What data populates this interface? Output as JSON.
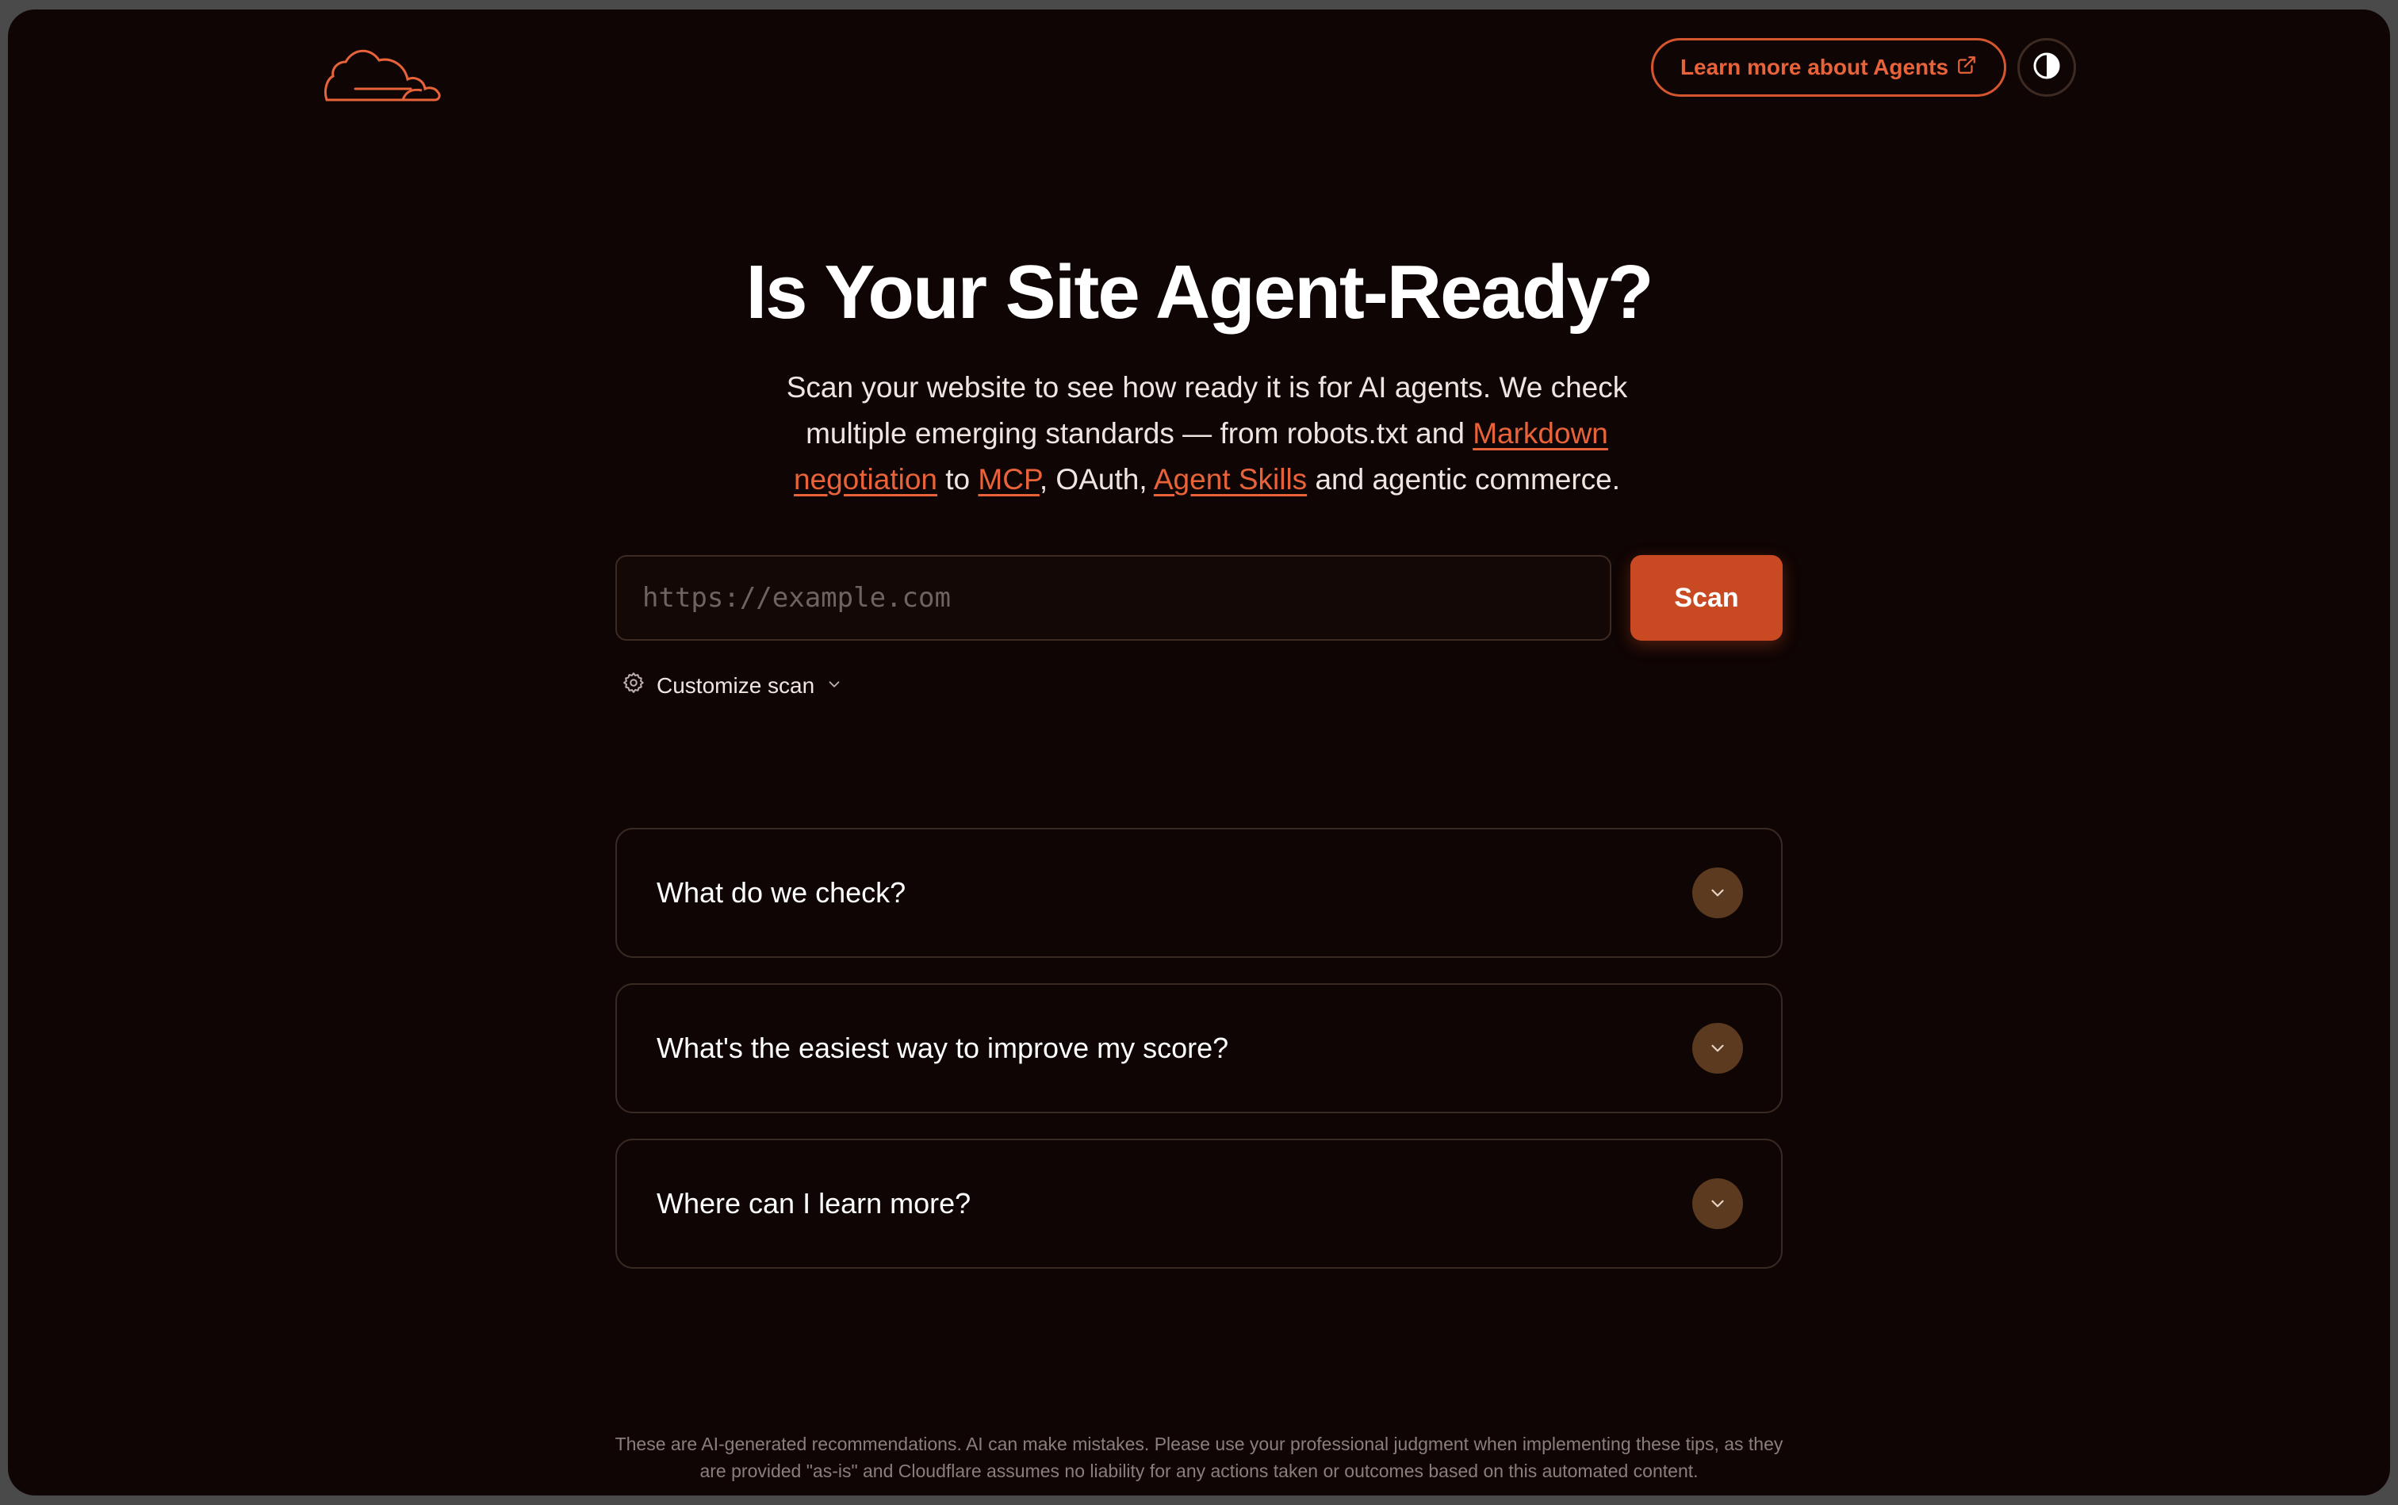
{
  "header": {
    "learn_label": "Learn more about Agents",
    "icons": {
      "logo": "cloudflare-cloud-logo",
      "external": "external-link-icon",
      "theme": "contrast-icon"
    }
  },
  "hero": {
    "title": "Is Your Site Agent-Ready?",
    "subtitle_part1": "Scan your website to see how ready it is for AI agents. We check multiple emerging standards — from robots.txt and ",
    "link_markdown": "Markdown negotiation",
    "subtitle_part2": " to ",
    "link_mcp": "MCP",
    "subtitle_part3": ", OAuth, ",
    "link_skills": "Agent Skills",
    "subtitle_part4": " and agentic commerce."
  },
  "scan": {
    "placeholder": "https://example.com",
    "button_label": "Scan",
    "customize_label": "Customize scan"
  },
  "faq": [
    {
      "question": "What do we check?"
    },
    {
      "question": "What's the easiest way to improve my score?"
    },
    {
      "question": "Where can I learn more?"
    }
  ],
  "footer": {
    "disclaimer_line1": "These are AI-generated recommendations. AI can make mistakes. Please use your professional judgment when implementing these tips, as they",
    "disclaimer_line2": "are provided \"as-is\" and Cloudflare assumes no liability for any actions taken or outcomes based on this automated content."
  },
  "colors": {
    "background": "#0f0504",
    "accent": "#e8633a",
    "button": "#c94a22",
    "chevron_bg": "#5c3a20"
  }
}
